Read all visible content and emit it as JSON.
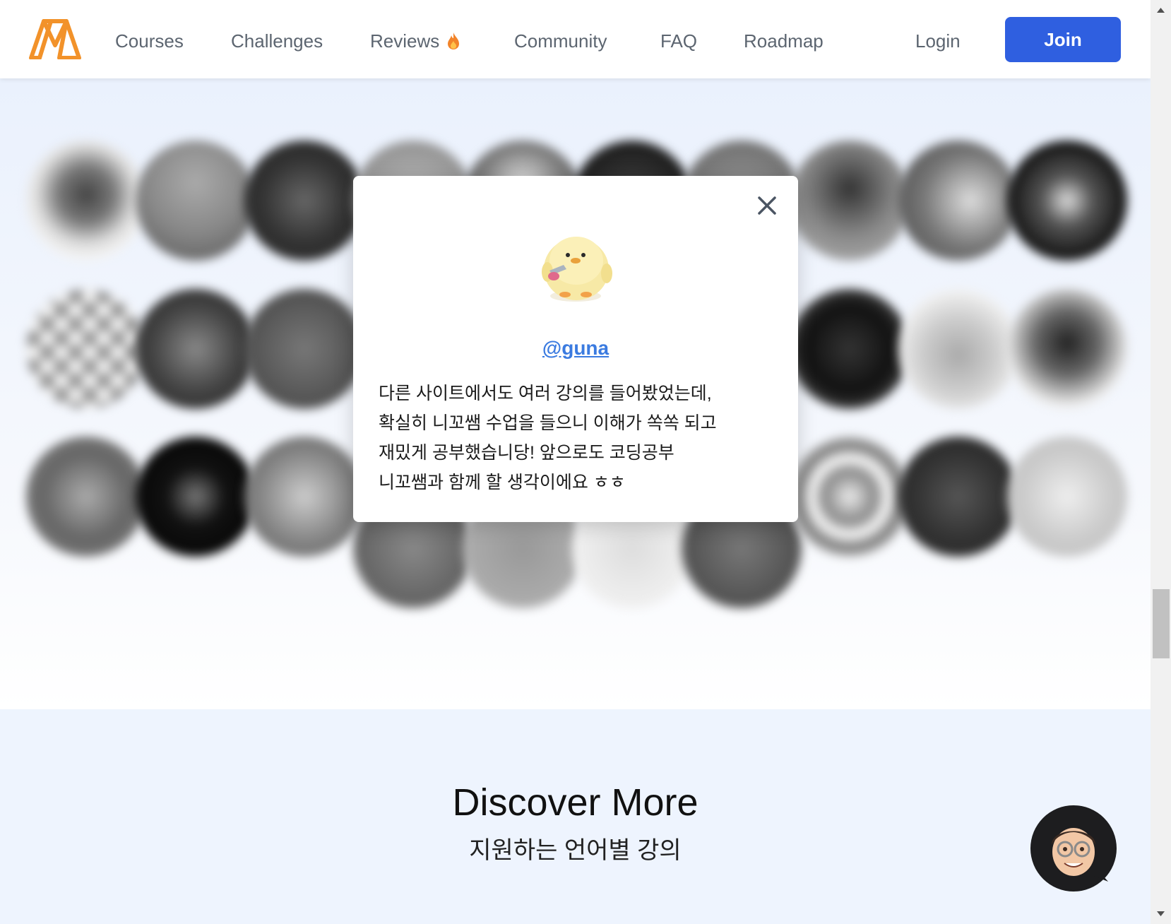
{
  "nav": {
    "items": [
      {
        "label": "Courses"
      },
      {
        "label": "Challenges"
      },
      {
        "label": "Reviews"
      },
      {
        "label": "Community"
      },
      {
        "label": "FAQ"
      },
      {
        "label": "Roadmap"
      }
    ],
    "login_label": "Login",
    "join_label": "Join"
  },
  "modal": {
    "username": "@guna",
    "review_lines": [
      "다른 사이트에서도 여러 강의를 들어봤었는데,",
      "확실히 니꼬쌤 수업을 들으니 이해가 쏙쏙 되고",
      "재밌게 공부했습니당! 앞으로도 코딩공부",
      "니꼬쌤과 함께 할 생각이에요 ㅎㅎ"
    ]
  },
  "discover": {
    "title": "Discover More",
    "subtitle": "지원하는 언어별 강의"
  },
  "colors": {
    "brand_orange": "#f2922a",
    "join_blue": "#2f5fe0",
    "link_blue": "#3b7be0",
    "hero_bg": "#eaf1fd",
    "discover_bg": "#eef4fe"
  },
  "icons": {
    "logo": "logo-icon",
    "flame": "flame-icon",
    "close": "close-icon",
    "duck": "duck-avatar",
    "chat": "chat-avatar"
  }
}
